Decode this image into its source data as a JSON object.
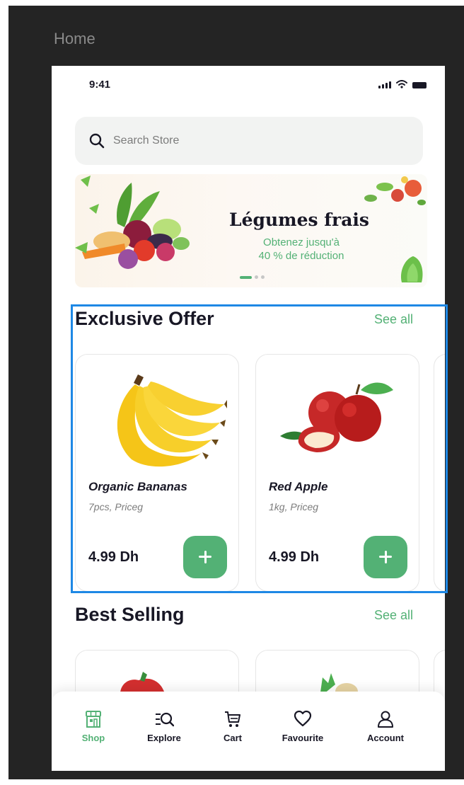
{
  "frame": {
    "label": "Home"
  },
  "status_bar": {
    "time": "9:41"
  },
  "search": {
    "placeholder": "Search Store"
  },
  "banner": {
    "title": "Légumes frais",
    "subtitle_line1": "Obtenez jusqu'à",
    "subtitle_line2": "40 % de réduction",
    "slide_count": 3,
    "active_slide": 1
  },
  "exclusive_offer": {
    "title": "Exclusive Offer",
    "see_all": "See all",
    "products": [
      {
        "name": "Organic Bananas",
        "detail": "7pcs, Priceg",
        "price": "4.99 Dh",
        "image_icon": "banana-bunch-icon"
      },
      {
        "name": "Red Apple",
        "detail": "1kg, Priceg",
        "price": "4.99 Dh",
        "image_icon": "red-apple-icon"
      }
    ]
  },
  "best_selling": {
    "title": "Best Selling",
    "see_all": "See all"
  },
  "bottom_nav": {
    "items": [
      {
        "label": "Shop",
        "icon": "shop-icon",
        "active": true
      },
      {
        "label": "Explore",
        "icon": "explore-icon",
        "active": false
      },
      {
        "label": "Cart",
        "icon": "cart-icon",
        "active": false
      },
      {
        "label": "Favourite",
        "icon": "heart-icon",
        "active": false
      },
      {
        "label": "Account",
        "icon": "account-icon",
        "active": false
      }
    ]
  },
  "colors": {
    "accent": "#53b175",
    "text_dark": "#181725",
    "text_muted": "#7c7c7c",
    "search_bg": "#f2f3f2",
    "highlight_border": "#1e88e5",
    "frame_bg": "#242424"
  }
}
